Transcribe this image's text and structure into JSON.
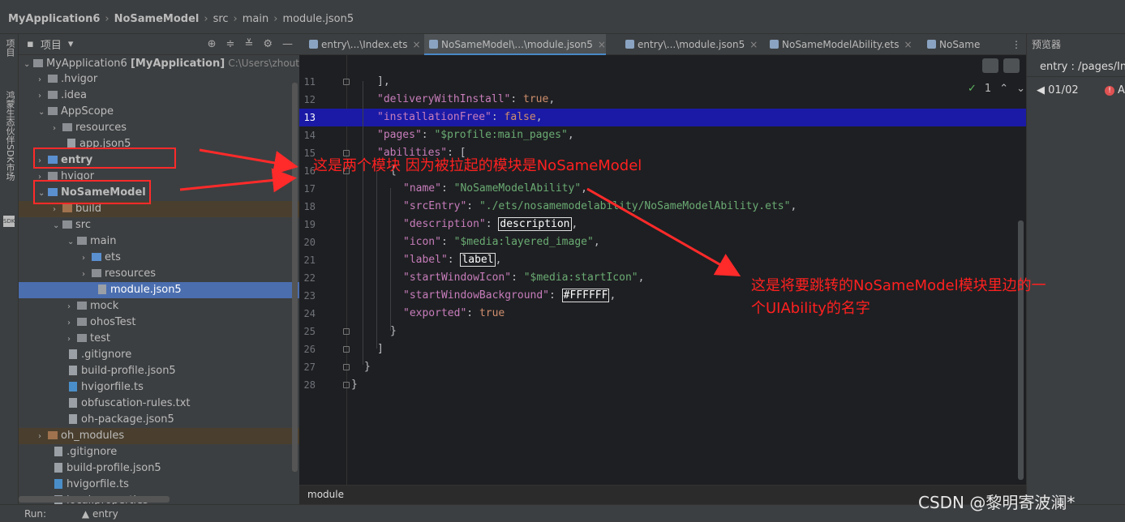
{
  "breadcrumb": {
    "project": "MyApplication6",
    "module": "NoSameModel",
    "src": "src",
    "main": "main",
    "file": "module.json5"
  },
  "sidebar": {
    "project_tab": "项目",
    "sdk_tab": "鸿蒙生态伙伴SDK市场",
    "sdk_badge": "SDK"
  },
  "project_panel": {
    "title": "项目",
    "tree": [
      {
        "arrow": "⌄",
        "label": "MyApplication6",
        "strong_part": "[MyApplication]",
        "path": "C:\\Users\\zhoutian"
      },
      {
        "arrow": "›",
        "label": ".hvigor"
      },
      {
        "arrow": "›",
        "label": ".idea"
      },
      {
        "arrow": "⌄",
        "label": "AppScope"
      },
      {
        "arrow": "›",
        "label": "resources"
      },
      {
        "arrow": "",
        "label": "app.json5"
      },
      {
        "arrow": "›",
        "label": "entry"
      },
      {
        "arrow": "›",
        "label": "hvigor"
      },
      {
        "arrow": "⌄",
        "label": "NoSameModel"
      },
      {
        "arrow": "›",
        "label": "build"
      },
      {
        "arrow": "⌄",
        "label": "src"
      },
      {
        "arrow": "⌄",
        "label": "main"
      },
      {
        "arrow": "›",
        "label": "ets"
      },
      {
        "arrow": "›",
        "label": "resources"
      },
      {
        "arrow": "",
        "label": "module.json5"
      },
      {
        "arrow": "›",
        "label": "mock"
      },
      {
        "arrow": "›",
        "label": "ohosTest"
      },
      {
        "arrow": "›",
        "label": "test"
      },
      {
        "arrow": "",
        "label": ".gitignore"
      },
      {
        "arrow": "",
        "label": "build-profile.json5"
      },
      {
        "arrow": "",
        "label": "hvigorfile.ts"
      },
      {
        "arrow": "",
        "label": "obfuscation-rules.txt"
      },
      {
        "arrow": "",
        "label": "oh-package.json5"
      },
      {
        "arrow": "›",
        "label": "oh_modules"
      },
      {
        "arrow": "",
        "label": ".gitignore"
      },
      {
        "arrow": "",
        "label": "build-profile.json5"
      },
      {
        "arrow": "",
        "label": "hvigorfile.ts"
      },
      {
        "arrow": "",
        "label": "local.properties"
      }
    ]
  },
  "tabs": [
    {
      "label": "entry\\...\\Index.ets"
    },
    {
      "label": "NoSameModel\\...\\module.json5"
    },
    {
      "label": "entry\\...\\module.json5"
    },
    {
      "label": "NoSameModelAbility.ets"
    },
    {
      "label": "NoSame"
    }
  ],
  "editor": {
    "inspection_count": "1",
    "line_numbers": [
      "11",
      "12",
      "13",
      "14",
      "15",
      "16",
      "17",
      "18",
      "19",
      "20",
      "21",
      "22",
      "23",
      "24",
      "25",
      "26",
      "27",
      "28"
    ],
    "lines": {
      "l11": "],",
      "l12_key": "\"deliveryWithInstall\"",
      "l12_val": "true",
      "l13_key": "\"installationFree\"",
      "l13_val": "false",
      "l14_key": "\"pages\"",
      "l14_val": "\"$profile:main_pages\"",
      "l15_key": "\"abilities\"",
      "l15_val": "[",
      "l16": "{",
      "l17_key": "\"name\"",
      "l17_val": "\"NoSameModelAbility\"",
      "l18_key": "\"srcEntry\"",
      "l18_val": "\"./ets/nosamemodelability/NoSameModelAbility.ets\"",
      "l19_key": "\"description\"",
      "l19_val": "description",
      "l20_key": "\"icon\"",
      "l20_val": "\"$media:layered_image\"",
      "l21_key": "\"label\"",
      "l21_val": "label",
      "l22_key": "\"startWindowIcon\"",
      "l22_val": "\"$media:startIcon\"",
      "l23_key": "\"startWindowBackground\"",
      "l23_val": "#FFFFFF",
      "l24_key": "\"exported\"",
      "l24_val": "true",
      "l25": "}",
      "l26": "]",
      "l27": "}",
      "l28": "}"
    },
    "status": "module"
  },
  "previewer": {
    "title": "预览器",
    "page": "entry : /pages/Ind",
    "page_counter": "01/02",
    "warn": "A"
  },
  "run_bar": {
    "label": "Run:",
    "config": "entry"
  },
  "annotations": {
    "a1": "这是两个模块  因为被拉起的模块是NoSameModel",
    "a2_line1": "这是将要跳转的NoSameModel模块里边的一",
    "a2_line2": "个UIAbility的名字"
  },
  "watermark": "CSDN @黎明寄波澜*",
  "colors": {
    "annotation": "#ff2020",
    "selection": "#4b6eaf",
    "highlight_line": "#1a1aa6"
  }
}
